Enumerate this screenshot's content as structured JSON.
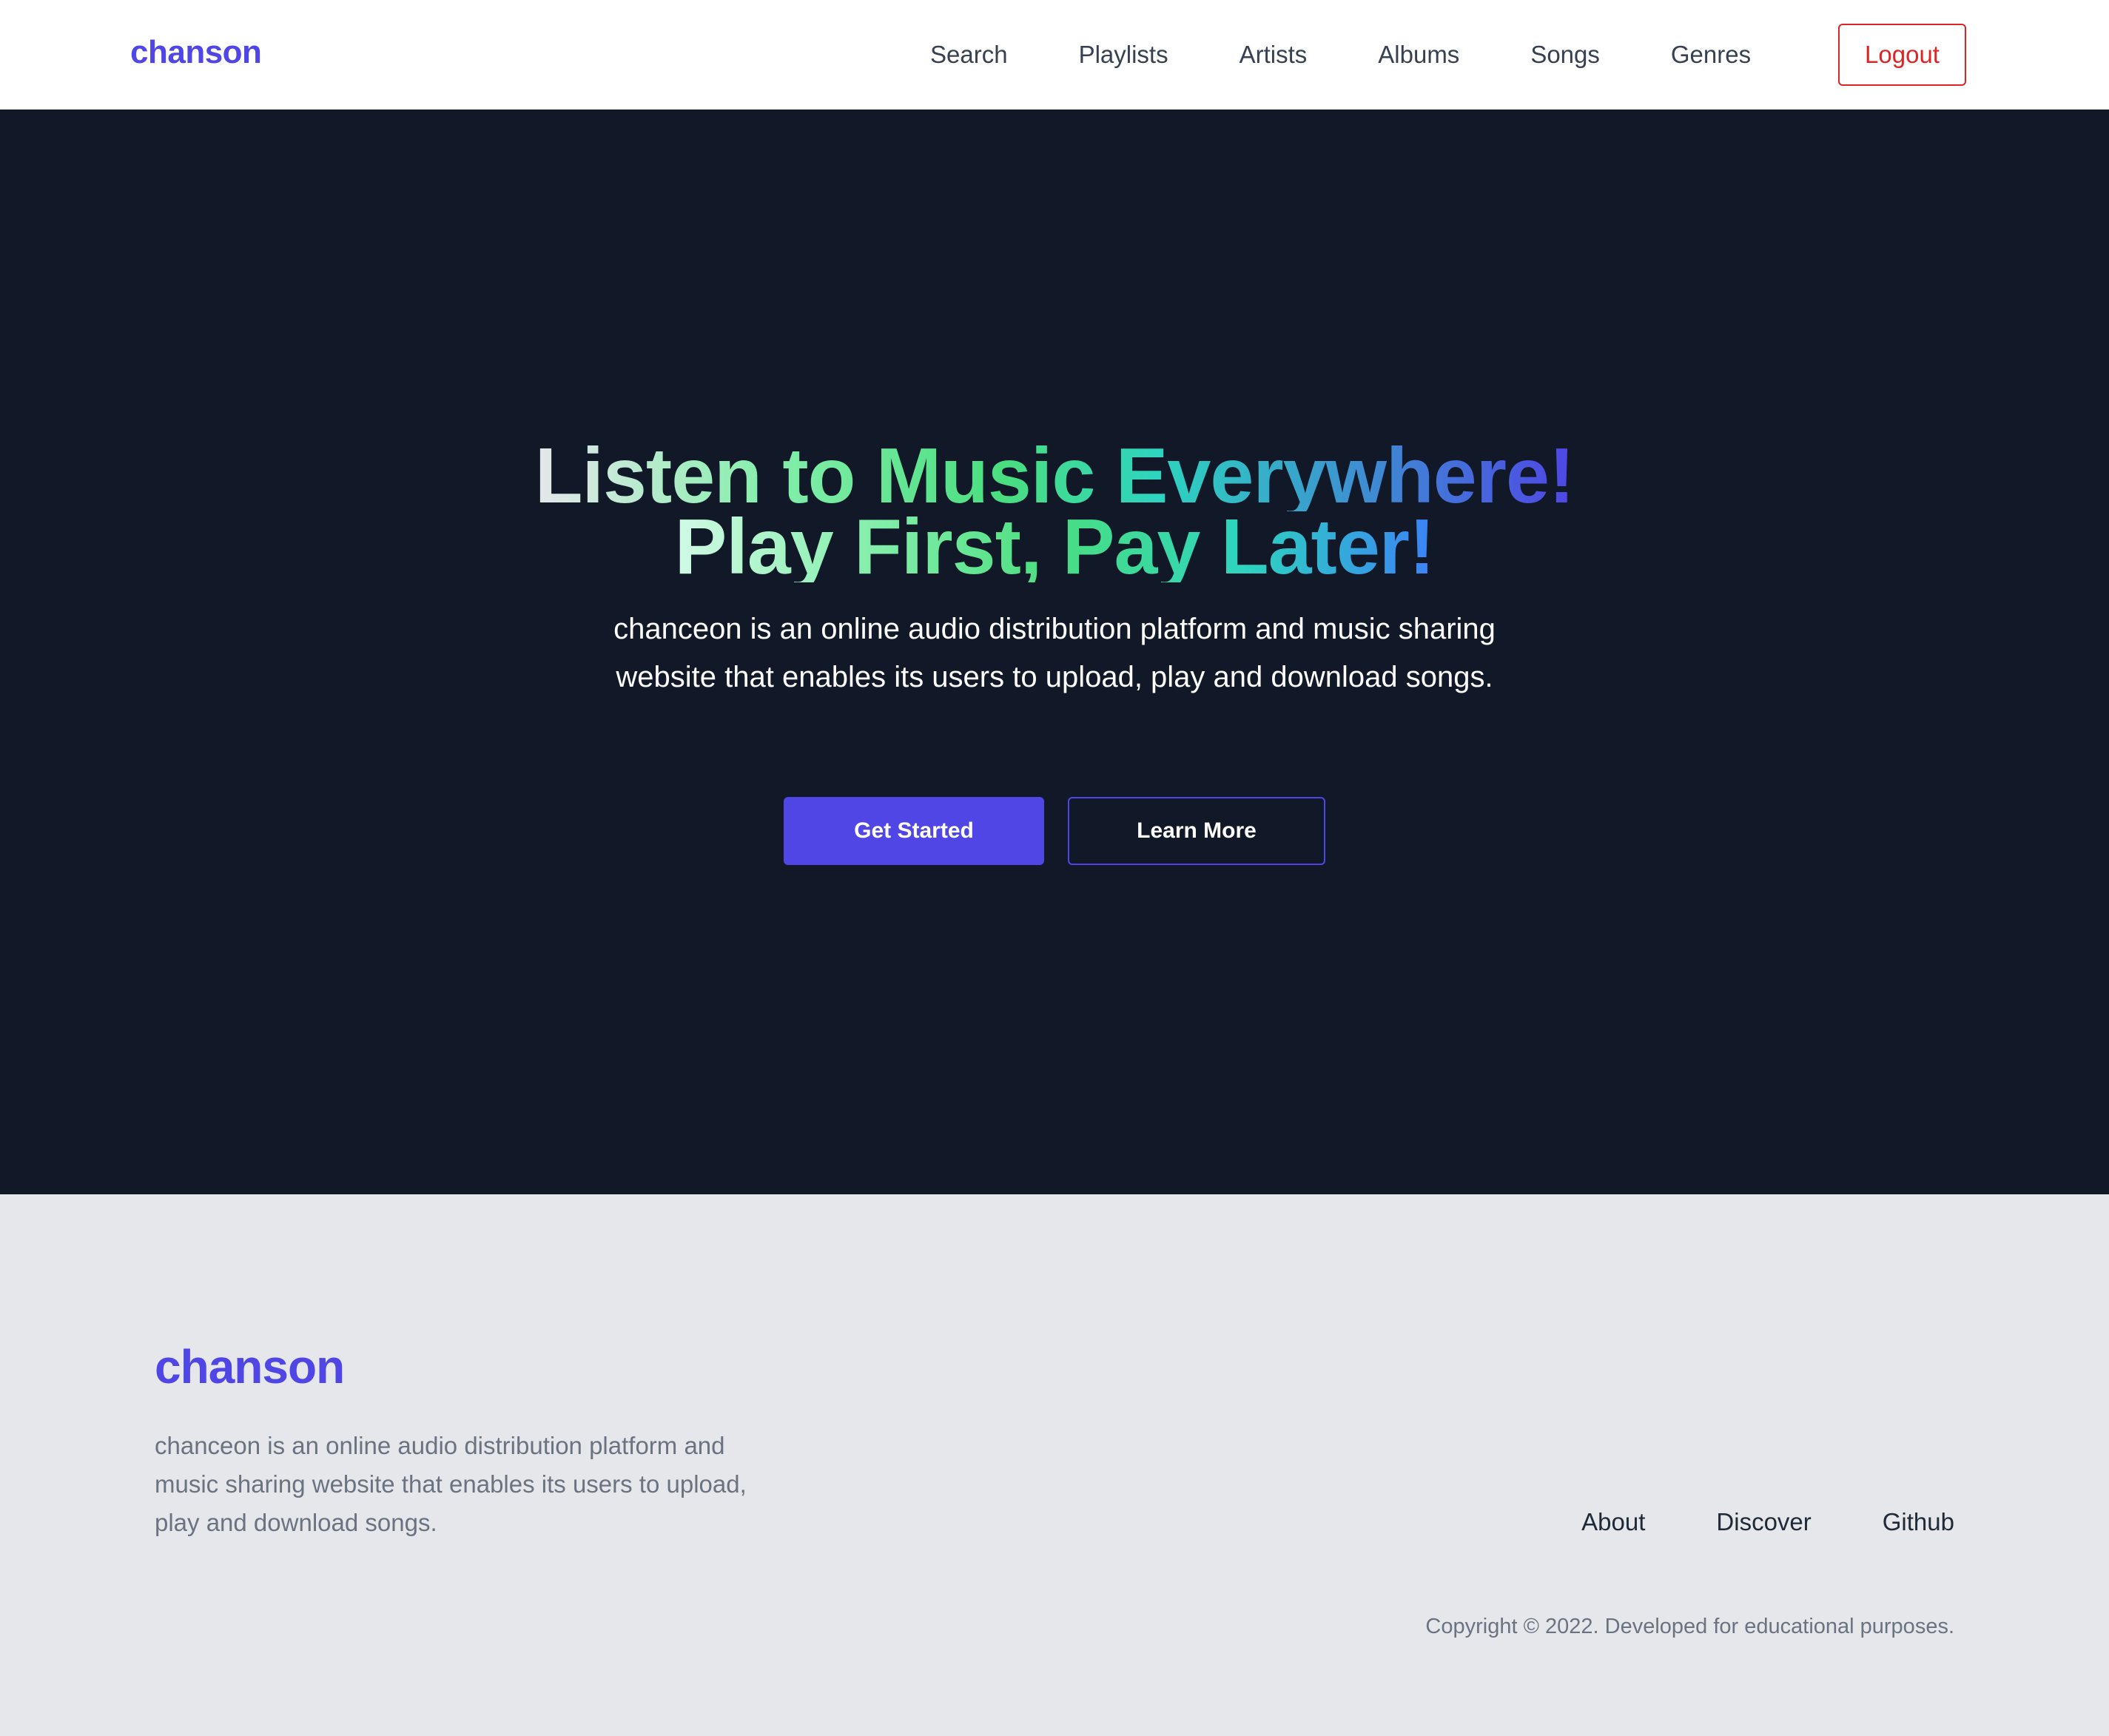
{
  "nav": {
    "logo": "chanson",
    "links": [
      "Search",
      "Playlists",
      "Artists",
      "Albums",
      "Songs",
      "Genres"
    ],
    "logout_label": "Logout"
  },
  "hero": {
    "title_line1": "Listen to Music Everywhere!",
    "title_line2": "Play First, Pay Later!",
    "subtitle": "chanceon is an online audio distribution platform and music sharing website that enables its users to upload, play and download songs.",
    "primary_button": "Get Started",
    "secondary_button": "Learn More"
  },
  "footer": {
    "logo": "chanson",
    "description": "chanceon is an online audio distribution platform and music sharing website that enables its users to upload, play and download songs.",
    "links": [
      "About",
      "Discover",
      "Github"
    ],
    "copyright": "Copyright © 2022. Developed for educational purposes."
  },
  "colors": {
    "brand": "#4f46e5",
    "logout": "#dc2626",
    "hero_bg": "#111827",
    "footer_bg": "#e5e7eb"
  }
}
